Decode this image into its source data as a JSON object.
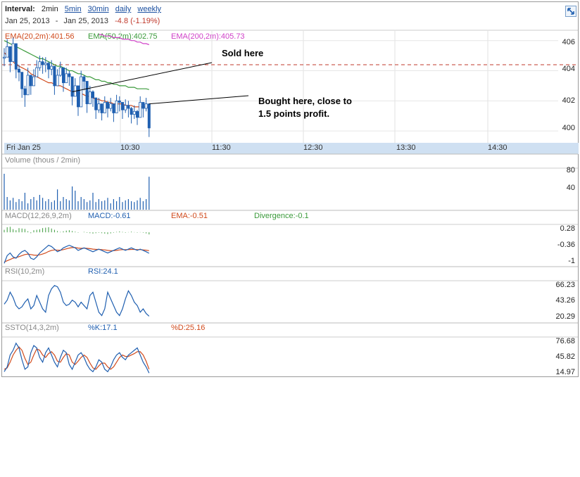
{
  "header": {
    "interval_label": "Interval:",
    "intervals": [
      {
        "label": "2min",
        "active": true
      },
      {
        "label": "5min",
        "active": false
      },
      {
        "label": "30min",
        "active": false
      },
      {
        "label": "daily",
        "active": false
      },
      {
        "label": "weekly",
        "active": false
      }
    ],
    "date_from": "Jan 25, 2013",
    "date_sep": "-",
    "date_to": "Jan 25, 2013",
    "change": "-4.8 (-1.19%)"
  },
  "icons": {
    "zoom": "expand-icon"
  },
  "colors": {
    "candle": "#1f5fb0",
    "ema20": "#d04a1c",
    "ema50": "#3a9a3a",
    "ema200": "#d040c8",
    "change": "#c0392b",
    "axis_band": "#cfe0f2",
    "ref_line": "#c0392b"
  },
  "chart_data": [
    {
      "type": "candlestick",
      "name": "price",
      "legend": [
        {
          "text": "EMA(20,2m):401.56",
          "color": "#d04a1c"
        },
        {
          "text": "EMA(50,2m):402.75",
          "color": "#3a9a3a"
        },
        {
          "text": "EMA(200,2m):405.73",
          "color": "#d040c8"
        }
      ],
      "y_ticks": [
        "406",
        "404",
        "402",
        "400"
      ],
      "ylim": [
        399.4,
        406.5
      ],
      "x_ticks": [
        "Fri Jan 25",
        "10:30",
        "11:30",
        "12:30",
        "13:30",
        "14:30"
      ],
      "reference_line": 404.4,
      "close": [
        404.9,
        405.6,
        404.6,
        405.8,
        404.1,
        403.9,
        402.8,
        402.4,
        403.7,
        403.0,
        403.6,
        404.2,
        404.6,
        404.4,
        404.5,
        404.1,
        404.3,
        403.0,
        403.7,
        404.2,
        403.2,
        403.8,
        403.6,
        402.3,
        403.0,
        401.6,
        403.6,
        403.3,
        401.8,
        402.6,
        402.2,
        401.4,
        401.8,
        401.2,
        401.9,
        401.5,
        401.8,
        401.2,
        402.0,
        401.9,
        401.4,
        401.7,
        401.5,
        401.1,
        401.3,
        400.9,
        401.9,
        401.5,
        401.8,
        400.2
      ],
      "high": [
        405.5,
        406.1,
        405.1,
        406.2,
        404.8,
        404.4,
        403.3,
        403.0,
        404.2,
        403.5,
        404.1,
        404.7,
        405.0,
        404.9,
        404.9,
        404.6,
        404.7,
        403.6,
        404.1,
        404.6,
        403.7,
        404.2,
        404.0,
        402.8,
        403.5,
        402.1,
        404.0,
        403.7,
        402.3,
        403.0,
        402.7,
        401.9,
        402.2,
        401.7,
        402.3,
        402.0,
        402.2,
        401.7,
        402.4,
        402.3,
        401.9,
        402.1,
        402.0,
        401.6,
        401.7,
        401.4,
        402.3,
        401.9,
        402.2,
        401.0
      ],
      "low": [
        404.3,
        405.0,
        403.9,
        405.2,
        403.5,
        403.3,
        402.2,
        401.6,
        403.0,
        402.4,
        403.0,
        403.6,
        404.0,
        403.8,
        403.9,
        403.5,
        403.7,
        402.4,
        403.1,
        403.6,
        402.6,
        403.2,
        403.0,
        401.7,
        402.5,
        401.0,
        403.0,
        402.7,
        401.2,
        402.0,
        401.6,
        400.8,
        401.2,
        400.7,
        401.4,
        400.9,
        401.3,
        400.6,
        401.5,
        401.3,
        400.8,
        401.2,
        400.9,
        400.5,
        400.8,
        400.4,
        401.3,
        400.9,
        401.3,
        399.6
      ],
      "ema20": [
        405.2,
        405.0,
        404.8,
        404.6,
        404.4,
        404.3,
        404.2,
        404.1,
        404.0,
        403.8,
        403.7,
        403.6,
        403.5,
        403.4,
        403.3,
        403.2,
        403.2,
        403.1,
        403.0,
        403.0,
        402.9,
        402.8,
        402.7,
        402.6,
        402.6,
        402.5,
        402.5,
        402.4,
        402.3,
        402.3,
        402.2,
        402.1,
        402.1,
        402.0,
        402.0,
        401.9,
        401.9,
        401.8,
        401.8,
        401.8,
        401.8,
        401.7,
        401.7,
        401.7,
        401.6,
        401.6,
        401.6,
        401.6,
        401.6,
        401.56
      ],
      "ema50": [
        406.0,
        405.9,
        405.8,
        405.7,
        405.6,
        405.5,
        405.4,
        405.3,
        405.2,
        405.1,
        405.0,
        404.9,
        404.8,
        404.8,
        404.7,
        404.6,
        404.5,
        404.4,
        404.3,
        404.3,
        404.2,
        404.1,
        404.0,
        404.0,
        403.9,
        403.8,
        403.8,
        403.7,
        403.6,
        403.6,
        403.5,
        403.4,
        403.4,
        403.3,
        403.3,
        403.2,
        403.2,
        403.1,
        403.1,
        403.0,
        403.0,
        403.0,
        402.9,
        402.9,
        402.9,
        402.8,
        402.8,
        402.8,
        402.8,
        402.75
      ],
      "ema200_x_from": 32,
      "ema200": [
        406.4,
        406.4,
        406.3,
        406.3,
        406.3,
        406.2,
        406.2,
        406.2,
        406.1,
        406.1,
        406.1,
        406.0,
        406.0,
        405.9,
        405.9,
        405.8,
        405.8,
        405.73
      ]
    },
    {
      "type": "bar",
      "name": "volume",
      "title": "Volume (thous / 2min)",
      "y_ticks": [
        "80",
        "40"
      ],
      "ylim": [
        0,
        95
      ],
      "values": [
        85,
        30,
        22,
        28,
        18,
        25,
        20,
        40,
        15,
        25,
        30,
        22,
        35,
        28,
        20,
        25,
        18,
        22,
        48,
        20,
        30,
        25,
        22,
        55,
        45,
        20,
        30,
        25,
        18,
        22,
        40,
        18,
        25,
        20,
        22,
        28,
        15,
        25,
        20,
        30,
        18,
        22,
        25,
        20,
        18,
        22,
        28,
        20,
        25,
        78
      ]
    },
    {
      "type": "line",
      "name": "macd",
      "legend": [
        {
          "text": "MACD(12,26,9,2m)",
          "color": "#666666"
        },
        {
          "text": "MACD:-0.61",
          "color": "#1f5fb0"
        },
        {
          "text": "EMA:-0.51",
          "color": "#d04a1c"
        },
        {
          "text": "Divergence:-0.1",
          "color": "#3a9a3a"
        }
      ],
      "y_ticks": [
        "0.28",
        "-0.36",
        "-1"
      ],
      "ylim": [
        -1.1,
        0.45
      ],
      "macd": [
        -1.0,
        -0.7,
        -0.6,
        -0.75,
        -0.8,
        -0.65,
        -0.55,
        -0.5,
        -0.6,
        -0.8,
        -0.85,
        -0.75,
        -0.6,
        -0.5,
        -0.4,
        -0.3,
        -0.35,
        -0.45,
        -0.55,
        -0.5,
        -0.4,
        -0.35,
        -0.3,
        -0.35,
        -0.4,
        -0.5,
        -0.45,
        -0.4,
        -0.45,
        -0.5,
        -0.55,
        -0.5,
        -0.45,
        -0.5,
        -0.55,
        -0.6,
        -0.55,
        -0.5,
        -0.45,
        -0.4,
        -0.45,
        -0.5,
        -0.45,
        -0.4,
        -0.45,
        -0.5,
        -0.45,
        -0.5,
        -0.55,
        -0.61
      ],
      "signal": [
        -0.95,
        -0.9,
        -0.85,
        -0.8,
        -0.78,
        -0.74,
        -0.7,
        -0.66,
        -0.64,
        -0.66,
        -0.68,
        -0.69,
        -0.67,
        -0.64,
        -0.6,
        -0.54,
        -0.5,
        -0.48,
        -0.49,
        -0.49,
        -0.47,
        -0.44,
        -0.41,
        -0.39,
        -0.39,
        -0.41,
        -0.42,
        -0.41,
        -0.42,
        -0.43,
        -0.45,
        -0.46,
        -0.46,
        -0.47,
        -0.48,
        -0.5,
        -0.51,
        -0.51,
        -0.5,
        -0.48,
        -0.47,
        -0.47,
        -0.47,
        -0.46,
        -0.46,
        -0.47,
        -0.47,
        -0.48,
        -0.49,
        -0.51
      ],
      "divergence": [
        0.12,
        0.24,
        0.26,
        0.15,
        0.1,
        0.2,
        0.18,
        0.16,
        0.05,
        -0.04,
        0.1,
        0.12,
        0.14,
        0.2,
        0.22,
        0.24,
        0.18,
        0.12,
        0.06,
        0.02,
        0.05,
        0.08,
        0.1,
        0.06,
        0.03,
        -0.02,
        0.0,
        0.02,
        -0.02,
        -0.04,
        -0.06,
        -0.04,
        -0.02,
        -0.04,
        -0.06,
        -0.08,
        -0.05,
        -0.02,
        0.02,
        0.04,
        0.02,
        -0.02,
        0.01,
        0.03,
        0.01,
        -0.02,
        0.01,
        -0.02,
        -0.05,
        -0.1
      ]
    },
    {
      "type": "line",
      "name": "rsi",
      "legend": [
        {
          "text": "RSI(10,2m)",
          "color": "#666666"
        },
        {
          "text": "RSI:24.1",
          "color": "#1f5fb0"
        }
      ],
      "y_ticks": [
        "66.23",
        "43.26",
        "20.29"
      ],
      "ylim": [
        15,
        75
      ],
      "values": [
        42,
        48,
        60,
        52,
        40,
        35,
        38,
        45,
        50,
        35,
        40,
        55,
        45,
        35,
        30,
        55,
        65,
        70,
        68,
        60,
        45,
        40,
        42,
        48,
        45,
        38,
        45,
        40,
        35,
        55,
        60,
        45,
        30,
        25,
        35,
        60,
        50,
        40,
        30,
        25,
        35,
        50,
        62,
        55,
        45,
        40,
        30,
        35,
        28,
        24.1
      ]
    },
    {
      "type": "line",
      "name": "ssto",
      "legend": [
        {
          "text": "SSTO(14,3,2m)",
          "color": "#666666"
        },
        {
          "text": "%K:17.1",
          "color": "#1f5fb0"
        },
        {
          "text": "%D:25.16",
          "color": "#d04a1c"
        }
      ],
      "y_ticks": [
        "76.68",
        "45.82",
        "14.97"
      ],
      "ylim": [
        10,
        90
      ],
      "k": [
        20,
        30,
        55,
        65,
        80,
        70,
        45,
        25,
        30,
        60,
        75,
        70,
        50,
        40,
        60,
        70,
        55,
        40,
        30,
        50,
        65,
        60,
        35,
        25,
        40,
        55,
        60,
        50,
        35,
        25,
        20,
        30,
        45,
        40,
        25,
        20,
        30,
        45,
        55,
        60,
        50,
        45,
        55,
        60,
        65,
        70,
        55,
        40,
        30,
        17.1
      ],
      "d": [
        25,
        28,
        40,
        55,
        65,
        72,
        65,
        48,
        35,
        40,
        55,
        68,
        65,
        55,
        50,
        58,
        62,
        55,
        42,
        40,
        50,
        58,
        55,
        40,
        35,
        42,
        50,
        55,
        50,
        38,
        28,
        25,
        32,
        38,
        38,
        30,
        25,
        30,
        40,
        50,
        55,
        52,
        52,
        55,
        58,
        62,
        62,
        55,
        42,
        25.16
      ]
    }
  ],
  "annotations": {
    "sold": "Sold here",
    "bought_line1": "Bought here, close to",
    "bought_line2": "1.5 points profit."
  }
}
